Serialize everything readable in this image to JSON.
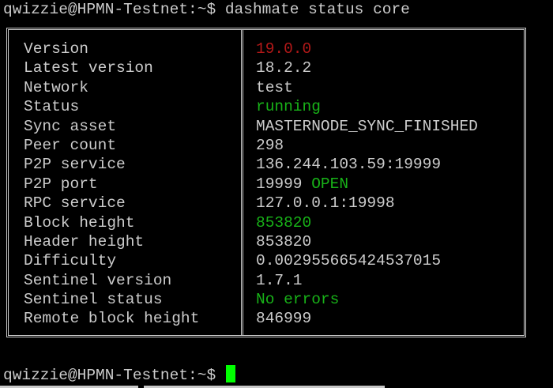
{
  "terminal": {
    "host": "qwizzie@HPMN-Testnet",
    "path": "~",
    "prompt_symbol": "$",
    "command": "dashmate status core",
    "prompt_top": "qwizzie@HPMN-Testnet:~$ dashmate status core",
    "prompt_bottom": "qwizzie@HPMN-Testnet:~$ "
  },
  "colors": {
    "background": "#000000",
    "text": "#cccccc",
    "red": "#b21818",
    "green": "#18b218",
    "cursor": "#00ff00"
  },
  "status": {
    "rows": [
      {
        "key": "Version",
        "value": "19.0.0",
        "color": "red"
      },
      {
        "key": "Latest version",
        "value": "18.2.2"
      },
      {
        "key": "Network",
        "value": "test"
      },
      {
        "key": "Status",
        "value": "running",
        "color": "green"
      },
      {
        "key": "Sync asset",
        "value": "MASTERNODE_SYNC_FINISHED"
      },
      {
        "key": "Peer count",
        "value": "298"
      },
      {
        "key": "P2P service",
        "value": "136.244.103.59:19999"
      },
      {
        "key": "P2P port",
        "value": "19999",
        "suffix": "OPEN",
        "suffix_color": "green"
      },
      {
        "key": "RPC service",
        "value": "127.0.0.1:19998"
      },
      {
        "key": "Block height",
        "value": "853820",
        "color": "green"
      },
      {
        "key": "Header height",
        "value": "853820"
      },
      {
        "key": "Difficulty",
        "value": "0.002955665424537015"
      },
      {
        "key": "Sentinel version",
        "value": "1.7.1"
      },
      {
        "key": "Sentinel status",
        "value": "No errors",
        "color": "green"
      },
      {
        "key": "Remote block height",
        "value": "846999"
      }
    ]
  }
}
